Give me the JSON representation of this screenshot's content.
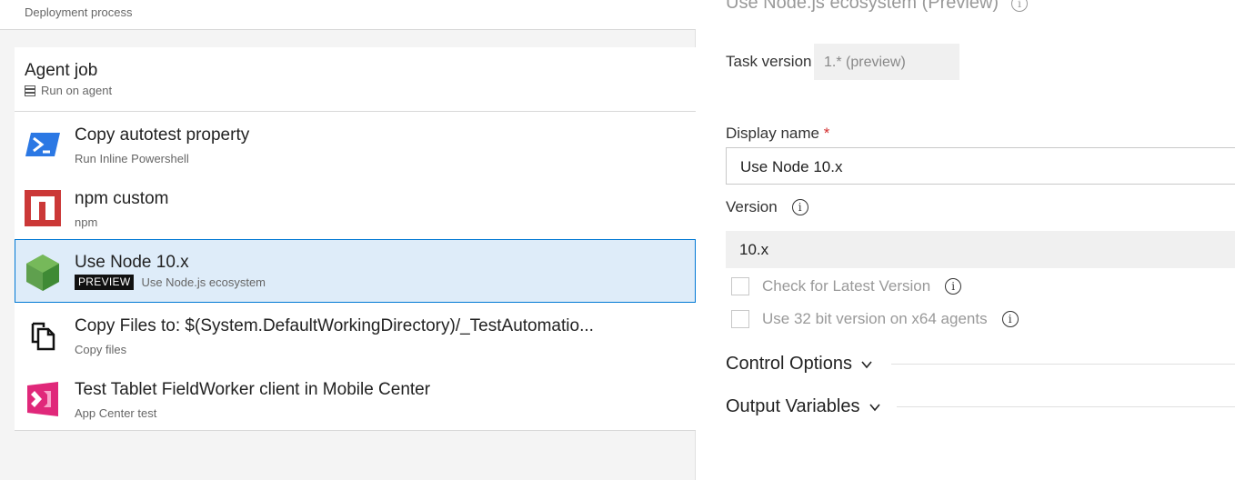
{
  "left": {
    "header_subtitle": "Deployment process",
    "agent_job": {
      "title": "Agent job",
      "subtitle": "Run on agent"
    },
    "tasks": [
      {
        "name": "Copy autotest property",
        "desc": "Run Inline Powershell",
        "icon": "powershell-icon",
        "selected": false
      },
      {
        "name": "npm custom",
        "desc": "npm",
        "icon": "npm-icon",
        "selected": false
      },
      {
        "name": "Use Node 10.x",
        "desc": "Use Node.js ecosystem",
        "badge": "PREVIEW",
        "icon": "nodejs-icon",
        "selected": true
      },
      {
        "name": "Copy Files to: $(System.DefaultWorkingDirectory)/_TestAutomatio...",
        "desc": "Copy files",
        "icon": "copy-files-icon",
        "selected": false
      },
      {
        "name": "Test Tablet FieldWorker client in Mobile Center",
        "desc": "App Center test",
        "icon": "app-center-test-icon",
        "selected": false
      }
    ]
  },
  "right": {
    "title": "Use Node.js ecosystem (Preview)",
    "task_version_label": "Task version",
    "task_version_value": "1.* (preview)",
    "display_name_label": "Display name",
    "display_name_required": "*",
    "display_name_value": "Use Node 10.x",
    "version_label": "Version",
    "version_value": "10.x",
    "check_latest_label": "Check for Latest Version",
    "use32_label": "Use 32 bit version on x64 agents",
    "control_options_label": "Control Options",
    "output_variables_label": "Output Variables"
  },
  "colors": {
    "selected_bg": "#deecf9",
    "selected_border": "#0078d4",
    "required": "#d32f2f"
  }
}
